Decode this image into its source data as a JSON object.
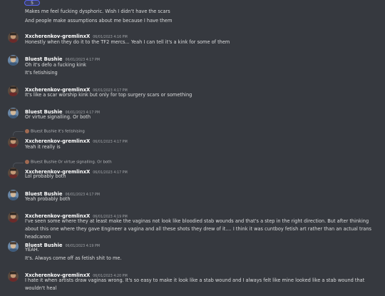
{
  "reaction": {
    "count": "5"
  },
  "messages": [
    {
      "text": "Makes me feel fucking dysphoric. Wish I didn't have the scars"
    },
    {
      "text": "And people make assumptions about me because I have them"
    },
    {
      "user": "Xxcherenkov-gremlinxX",
      "time": "06/01/2023 4:16 PM",
      "text": "Honestly when they do it to the TF2 mercs... Yeah I can tell it's a kink for some of them"
    },
    {
      "user": "Bluest Bushie",
      "time": "06/01/2023 4:17 PM",
      "lines": [
        "Oh it's defo a fucking kink",
        "It's fetishising"
      ]
    },
    {
      "user": "Xxcherenkov-gremlinxX",
      "time": "06/01/2023 4:17 PM",
      "text": "It's like a scar worship kink but only for top surgery scars or something"
    },
    {
      "user": "Bluest Bushie",
      "time": "06/01/2023 4:17 PM",
      "text": "Or virtue signalling. Or both"
    },
    {
      "reply": "Bluest Bushie It's fetishising",
      "user": "Xxcherenkov-gremlinxX",
      "time": "06/01/2023 4:17 PM",
      "text": "Yeah it really is"
    },
    {
      "reply": "Bluest Bushie Or virtue signalling. Or both",
      "user": "Xxcherenkov-gremlinxX",
      "time": "06/01/2023 4:17 PM",
      "text": "Lol probably both"
    },
    {
      "user": "Bluest Bushie",
      "time": "06/01/2023 4:17 PM",
      "text": "Yeah probably both"
    },
    {
      "user": "Xxcherenkov-gremlinxX",
      "time": "06/01/2023 4:19 PM",
      "text": "I've seen some where they at least make the vaginas not look like bloodied stab wounds and that's a step in the right direction. But after thinking about this one where they gave Engineer a vagina and all these shots they drew of it.... I think it was cuntboy fetish art rather than an actual trans headcanon"
    },
    {
      "user": "Bluest Bushie",
      "time": "06/01/2023 4:19 PM",
      "lines": [
        "YEAH.",
        "It's. Always come off as fetish shit to me."
      ]
    },
    {
      "user": "Xxcherenkov-gremlinxX",
      "time": "06/01/2023 4:20 PM",
      "text": "I hate it when artists draw vaginas wrong. It's so easy to make it look like a stab wound and I always felt like mine looked like a stab wound that wouldn't heal"
    }
  ]
}
